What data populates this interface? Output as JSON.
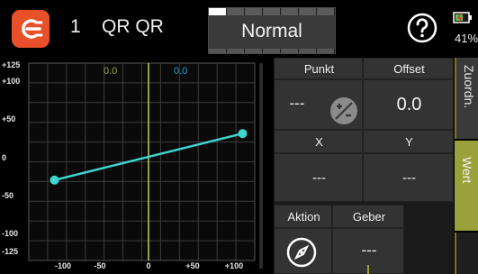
{
  "topbar": {
    "model_number": "1",
    "model_name": "QR QR",
    "mode_label": "Normal",
    "battery_percent": "41%",
    "icons": {
      "app": "model-selector-icon",
      "help": "help-icon",
      "battery": "battery-icon"
    }
  },
  "graph": {
    "y_ticks": [
      "+125",
      "+100",
      "+50",
      "0",
      "-50",
      "-100",
      "-125"
    ],
    "x_ticks": [
      "-100",
      "-50",
      "0",
      "+50",
      "+100"
    ],
    "input_value": "0.0",
    "output_value": "0.0",
    "colors": {
      "curve": "#3fd6d0",
      "input_marker": "#c8d44a",
      "output_value": "#1f9fce",
      "grid": "#3c3c3c"
    },
    "curve_points": [
      {
        "x": -100,
        "y": -30
      },
      {
        "x": 100,
        "y": 30
      }
    ]
  },
  "panel": {
    "punkt_label": "Punkt",
    "offset_label": "Offset",
    "punkt_value": "---",
    "offset_value": "0.0",
    "x_label": "X",
    "y_label": "Y",
    "x_value": "---",
    "y_value": "---",
    "aktion_label": "Aktion",
    "geber_label": "Geber",
    "geber_value": "---",
    "icons": {
      "point_toggle": "plus-minus-icon",
      "action": "compass-icon"
    }
  },
  "side_tabs": {
    "assign_label": "Zuordn.",
    "value_label": "Wert"
  },
  "colors": {
    "accent": "#e8502a",
    "tab_active": "#9aa03a"
  }
}
